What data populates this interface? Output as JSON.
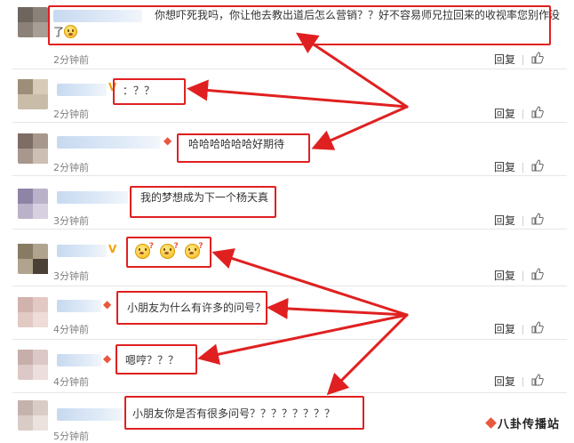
{
  "comments": [
    {
      "text": "你想吓死我吗，你让他去教出道后怎么营销？？好不容易师兄拉回来的收视率您别作没",
      "text2": "了",
      "time": "2分钟前",
      "reply": "回复"
    },
    {
      "text": "：？？",
      "time": "2分钟前",
      "reply": "回复"
    },
    {
      "text": "哈哈哈哈哈哈好期待",
      "time": "2分钟前",
      "reply": "回复"
    },
    {
      "text": "我的梦想成为下一个杨天真",
      "time": "3分钟前",
      "reply": "回复"
    },
    {
      "text": "",
      "time": "3分钟前",
      "reply": "回复"
    },
    {
      "text": "小朋友为什么有许多的问号？",
      "time": "4分钟前",
      "reply": "回复"
    },
    {
      "text": "嗯哼？？？",
      "time": "4分钟前",
      "reply": "回复"
    },
    {
      "text": "小朋友你是否有很多问号？？？？？？？？",
      "time": "5分钟前",
      "reply": "回复"
    }
  ],
  "badges": {
    "vip": "V",
    "gold": "◆"
  },
  "icons": {
    "like": "thumbs-up-icon",
    "emoji": "smile-emoji-icon",
    "question_emoji": "question-face-emoji-icon"
  },
  "watermark": "八卦传播站",
  "colors": {
    "highlight": "#e02020",
    "link": "#333333",
    "time": "#808080"
  }
}
